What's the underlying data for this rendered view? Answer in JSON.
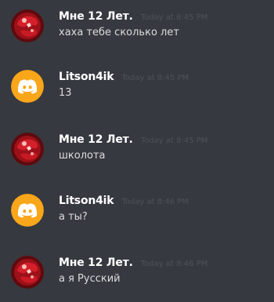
{
  "messages": [
    {
      "author": "Мне 12 Лет.",
      "timestamp": "Today at 8:45 PM",
      "text": "хаха тебе сколько лет",
      "avatar": "red-ball-avatar"
    },
    {
      "author": "Litson4ik",
      "timestamp": "Today at 8:45 PM",
      "text": "13",
      "avatar": "discord-default-avatar"
    },
    {
      "author": "Мне 12 Лет.",
      "timestamp": "Today at 8:45 PM",
      "text": "школота",
      "avatar": "red-ball-avatar"
    },
    {
      "author": "Litson4ik",
      "timestamp": "Today at 8:46 PM",
      "text": "а ты?",
      "avatar": "discord-default-avatar"
    },
    {
      "author": "Мне 12 Лет.",
      "timestamp": "Today at 8:46 PM",
      "text": "а я Русский",
      "avatar": "red-ball-avatar"
    }
  ],
  "colors": {
    "background": "#36393f",
    "username": "#ffffff",
    "timestamp": "#4e5258",
    "message_text": "#dcddde",
    "discord_avatar_bg": "#faa61a",
    "red_avatar": "#b3121c"
  }
}
